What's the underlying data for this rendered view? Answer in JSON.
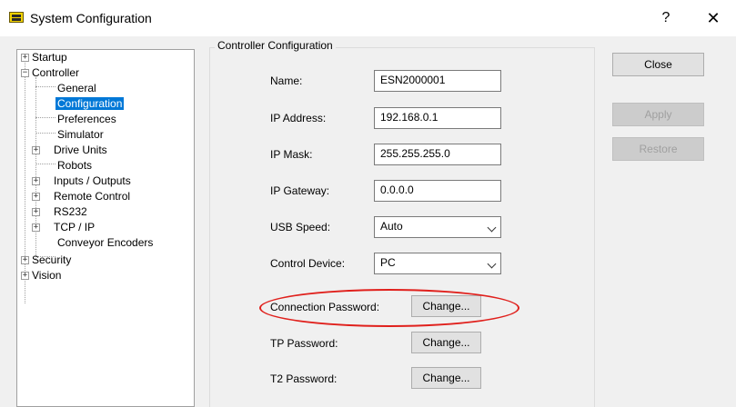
{
  "window": {
    "title": "System Configuration",
    "help_label": "?",
    "close_label": "✕"
  },
  "tree": {
    "items": [
      {
        "label": "Startup"
      },
      {
        "label": "Controller"
      },
      {
        "label": "General"
      },
      {
        "label": "Configuration"
      },
      {
        "label": "Preferences"
      },
      {
        "label": "Simulator"
      },
      {
        "label": "Drive Units"
      },
      {
        "label": "Robots"
      },
      {
        "label": "Inputs / Outputs"
      },
      {
        "label": "Remote Control"
      },
      {
        "label": "RS232"
      },
      {
        "label": "TCP / IP"
      },
      {
        "label": "Conveyor Encoders"
      },
      {
        "label": "Security"
      },
      {
        "label": "Vision"
      }
    ],
    "selected": "Configuration"
  },
  "panel": {
    "group_title": "Controller Configuration",
    "name_label": "Name:",
    "name_value": "ESN2000001",
    "ip_address_label": "IP Address:",
    "ip_address_value": "192.168.0.1",
    "ip_mask_label": "IP Mask:",
    "ip_mask_value": "255.255.255.0",
    "ip_gateway_label": "IP Gateway:",
    "ip_gateway_value": "0.0.0.0",
    "usb_speed_label": "USB Speed:",
    "usb_speed_value": "Auto",
    "control_device_label": "Control Device:",
    "control_device_value": "PC",
    "connection_password_label": "Connection Password:",
    "tp_password_label": "TP Password:",
    "t2_password_label": "T2 Password:",
    "change_label": "Change..."
  },
  "buttons": {
    "close": "Close",
    "apply": "Apply",
    "restore": "Restore"
  },
  "icons": {
    "app": "controller-app-icon",
    "expand": "plus-box-icon",
    "collapse": "minus-box-icon",
    "dropdown": "chevron-down-icon"
  },
  "colors": {
    "selection": "#0078d7",
    "highlight_ellipse": "#e0201c"
  }
}
